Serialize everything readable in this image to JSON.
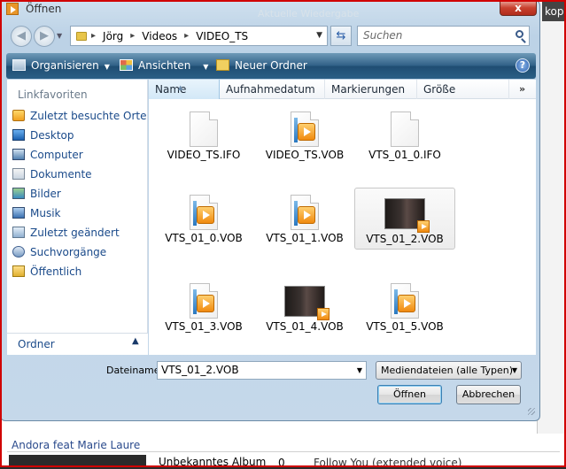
{
  "dialog": {
    "title": "Öffnen",
    "close_label": "x",
    "background_title": "Aktuelle Wiedergabe"
  },
  "address": {
    "crumbs": [
      "Jörg",
      "Videos",
      "VIDEO_TS"
    ],
    "search_placeholder": "Suchen"
  },
  "toolbar": {
    "organize": "Organisieren",
    "views": "Ansichten",
    "new_folder": "Neuer Ordner"
  },
  "sidebar": {
    "header": "Linkfavoriten",
    "items": [
      {
        "label": "Zuletzt besuchte Orte",
        "icon": "recent-places-icon"
      },
      {
        "label": "Desktop",
        "icon": "desktop-icon"
      },
      {
        "label": "Computer",
        "icon": "computer-icon"
      },
      {
        "label": "Dokumente",
        "icon": "documents-icon"
      },
      {
        "label": "Bilder",
        "icon": "pictures-icon"
      },
      {
        "label": "Musik",
        "icon": "music-icon"
      },
      {
        "label": "Zuletzt geändert",
        "icon": "recently-changed-icon"
      },
      {
        "label": "Suchvorgänge",
        "icon": "searches-icon"
      },
      {
        "label": "Öffentlich",
        "icon": "public-folder-icon"
      }
    ],
    "folders_label": "Ordner"
  },
  "columns": [
    "Name",
    "Aufnahmedatum",
    "Markierungen",
    "Größe"
  ],
  "files": [
    {
      "name": "VIDEO_TS.IFO",
      "kind": "ifo"
    },
    {
      "name": "VIDEO_TS.VOB",
      "kind": "vob"
    },
    {
      "name": "VTS_01_0.IFO",
      "kind": "ifo"
    },
    {
      "name": "VTS_01_0.VOB",
      "kind": "vob"
    },
    {
      "name": "VTS_01_1.VOB",
      "kind": "vob"
    },
    {
      "name": "VTS_01_2.VOB",
      "kind": "thumb",
      "selected": true
    },
    {
      "name": "VTS_01_3.VOB",
      "kind": "vob"
    },
    {
      "name": "VTS_01_4.VOB",
      "kind": "thumb"
    },
    {
      "name": "VTS_01_5.VOB",
      "kind": "vob"
    }
  ],
  "footer": {
    "filename_label": "Dateiname:",
    "filename_value": "VTS_01_2.VOB",
    "filetype_value": "Mediendateien (alle Typen)",
    "open_label": "Öffnen",
    "cancel_label": "Abbrechen"
  },
  "background_app": {
    "tab_label": "kopie",
    "artist": "Andora feat Marie Laure",
    "album": "Unbekanntes Album",
    "number": "0",
    "track": "Follow You (extended voice)"
  }
}
